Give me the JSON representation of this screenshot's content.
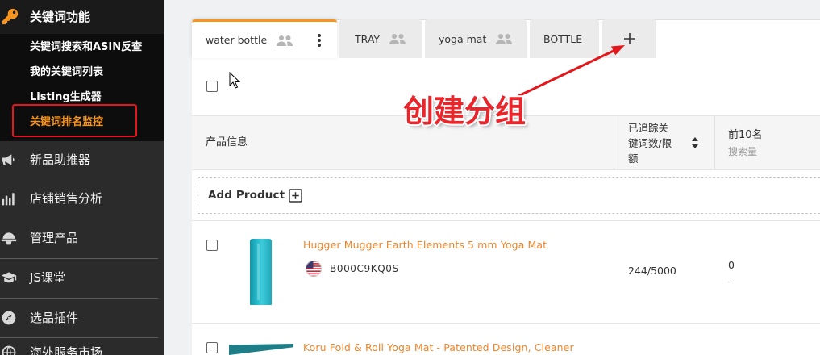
{
  "sidebar": {
    "section": {
      "title": "关键词功能",
      "icon": "key-icon"
    },
    "sub_items": [
      {
        "label": "关键词搜索和ASIN反查"
      },
      {
        "label": "我的关键词列表"
      },
      {
        "label": "Listing生成器"
      },
      {
        "label": "关键词排名监控",
        "active": true
      }
    ],
    "items": [
      {
        "label": "新品助推器",
        "icon": "megaphone-icon"
      },
      {
        "label": "店铺销售分析",
        "icon": "bar-chart-icon"
      },
      {
        "label": "管理产品",
        "icon": "cap-icon"
      },
      {
        "label": "JS课堂",
        "icon": "graduation-cap-icon"
      },
      {
        "label": "选品插件",
        "icon": "compass-icon"
      },
      {
        "label": "海外服务市场",
        "icon": "globe-icon"
      }
    ]
  },
  "tabs": [
    {
      "label": "water bottle",
      "icon": "people-icon",
      "menu_icon": "kebab-menu-icon",
      "active": true
    },
    {
      "label": "TRAY",
      "icon": "people-icon"
    },
    {
      "label": "yoga mat",
      "icon": "people-icon"
    },
    {
      "label": "BOTTLE"
    }
  ],
  "add_tab": {
    "icon": "plus-icon"
  },
  "annotation": {
    "text": "创建分组"
  },
  "table": {
    "columns": {
      "product": "产品信息",
      "tracked_keywords": [
        "已追踪关",
        "键词数/限",
        "额"
      ],
      "top10": "前10名",
      "top10_sub": "搜索量"
    },
    "add_product_label": "Add Product",
    "rows": [
      {
        "title": "Hugger Mugger Earth Elements 5 mm Yoga Mat",
        "flag_icon": "us-flag-icon",
        "asin": "B000C9KQ0S",
        "tracked_keywords": "244/5000",
        "top10": "0",
        "search_volume": "--"
      },
      {
        "title": "Koru Fold & Roll Yoga Mat - Patented Design, Cleaner"
      }
    ]
  },
  "colors": {
    "accent": "#f7941d",
    "annotation_red": "#e3161c",
    "sidebar_bg": "#2b2b2b",
    "product_image_teal": "#27bccd"
  }
}
